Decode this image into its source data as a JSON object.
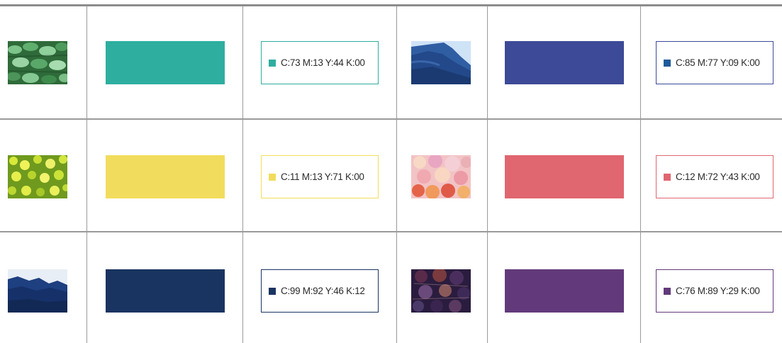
{
  "rows": [
    {
      "left": {
        "image": "green-leaves-photo",
        "color": "#2eae9f",
        "cmyk": "C:73 M:13 Y:44 K:00"
      },
      "right": {
        "image": "blue-mountain-photo",
        "color": "#3d4a97",
        "cmyk": "C:85 M:77 Y:09 K:00"
      }
    },
    {
      "left": {
        "image": "yellow-flowers-photo",
        "color": "#f2dc5d",
        "cmyk": "C:11 M:13 Y:71 K:00"
      },
      "right": {
        "image": "pink-blossom-photo",
        "color": "#e06670",
        "cmyk": "C:12 M:72 Y:43 K:00"
      }
    },
    {
      "left": {
        "image": "navy-hills-photo",
        "color": "#1a3461",
        "cmyk": "C:99 M:92 Y:46 K:12"
      },
      "right": {
        "image": "purple-foliage-photo",
        "color": "#623a7b",
        "cmyk": "C:76 M:89 Y:29 K:00"
      }
    }
  ]
}
